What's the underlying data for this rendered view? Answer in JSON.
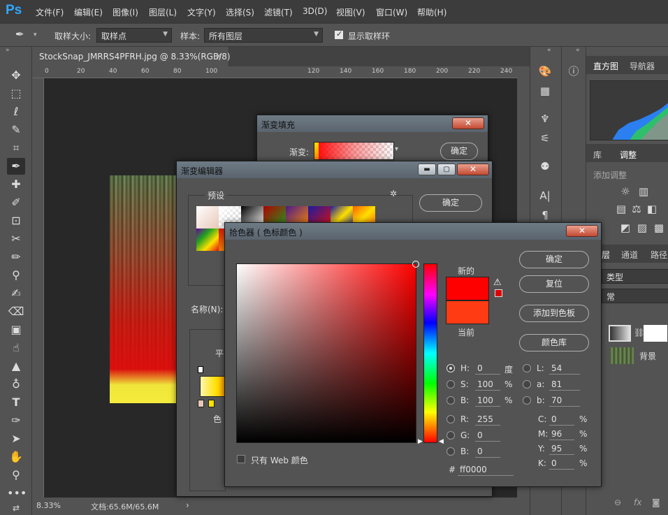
{
  "app": {
    "logo": "Ps"
  },
  "menu": [
    "文件(F)",
    "编辑(E)",
    "图像(I)",
    "图层(L)",
    "文字(Y)",
    "选择(S)",
    "滤镜(T)",
    "3D(D)",
    "视图(V)",
    "窗口(W)",
    "帮助(H)"
  ],
  "options": {
    "sample_size_label": "取样大小:",
    "sample_size_value": "取样点",
    "sample_label": "样本:",
    "sample_value": "所有图层",
    "show_ring_label": "显示取样环",
    "show_ring_checked": true
  },
  "document": {
    "tab_title": "StockSnap_JMRRS4PFRH.jpg @ 8.33%(RGB/8)",
    "tab_close": "×",
    "ruler_labels": [
      "0",
      "20",
      "40",
      "60",
      "80",
      "100",
      "120",
      "140",
      "160",
      "180",
      "200",
      "220",
      "240"
    ],
    "zoom": "8.33%",
    "doc_info": "文档:65.6M/65.6M",
    "status_arrow": "›"
  },
  "panels": {
    "tabs_top": [
      "直方图",
      "导航器"
    ],
    "tabs_mid": [
      "库",
      "调整"
    ],
    "add_adjustment": "添加调整",
    "tabs_layers": [
      "层",
      "通道",
      "路径"
    ],
    "layer_kind": "类型",
    "layer_mode": "常",
    "layer_bg_name": "背景"
  },
  "gradient_fill": {
    "title": "渐变填充",
    "gradient_label": "渐变:",
    "ok": "确定"
  },
  "gradient_editor": {
    "title": "渐变编辑器",
    "presets_label": "预设",
    "ok": "确定",
    "name_label": "名称(N):",
    "smooth_label": "平",
    "color_label": "色"
  },
  "color_picker": {
    "title": "拾色器 ( 色标颜色 )",
    "new_label": "新的",
    "current_label": "当前",
    "new_color": "#ff0000",
    "current_color": "#ff3b14",
    "buttons": {
      "ok": "确定",
      "reset": "复位",
      "add_swatch": "添加到色板",
      "color_lib": "颜色库"
    },
    "hsb": [
      {
        "label": "H:",
        "value": "0",
        "unit": "度",
        "checked": true
      },
      {
        "label": "S:",
        "value": "100",
        "unit": "%",
        "checked": false
      },
      {
        "label": "B:",
        "value": "100",
        "unit": "%",
        "checked": false
      }
    ],
    "rgb": [
      {
        "label": "R:",
        "value": "255"
      },
      {
        "label": "G:",
        "value": "0"
      },
      {
        "label": "B:",
        "value": "0"
      }
    ],
    "lab": [
      {
        "label": "L:",
        "value": "54"
      },
      {
        "label": "a:",
        "value": "81"
      },
      {
        "label": "b:",
        "value": "70"
      }
    ],
    "cmyk": [
      {
        "label": "C:",
        "value": "0",
        "unit": "%"
      },
      {
        "label": "M:",
        "value": "96",
        "unit": "%"
      },
      {
        "label": "Y:",
        "value": "95",
        "unit": "%"
      },
      {
        "label": "K:",
        "value": "0",
        "unit": "%"
      }
    ],
    "hex_label": "#",
    "hex_value": "ff0000",
    "web_only_label": "只有 Web 颜色",
    "web_only_checked": false
  }
}
